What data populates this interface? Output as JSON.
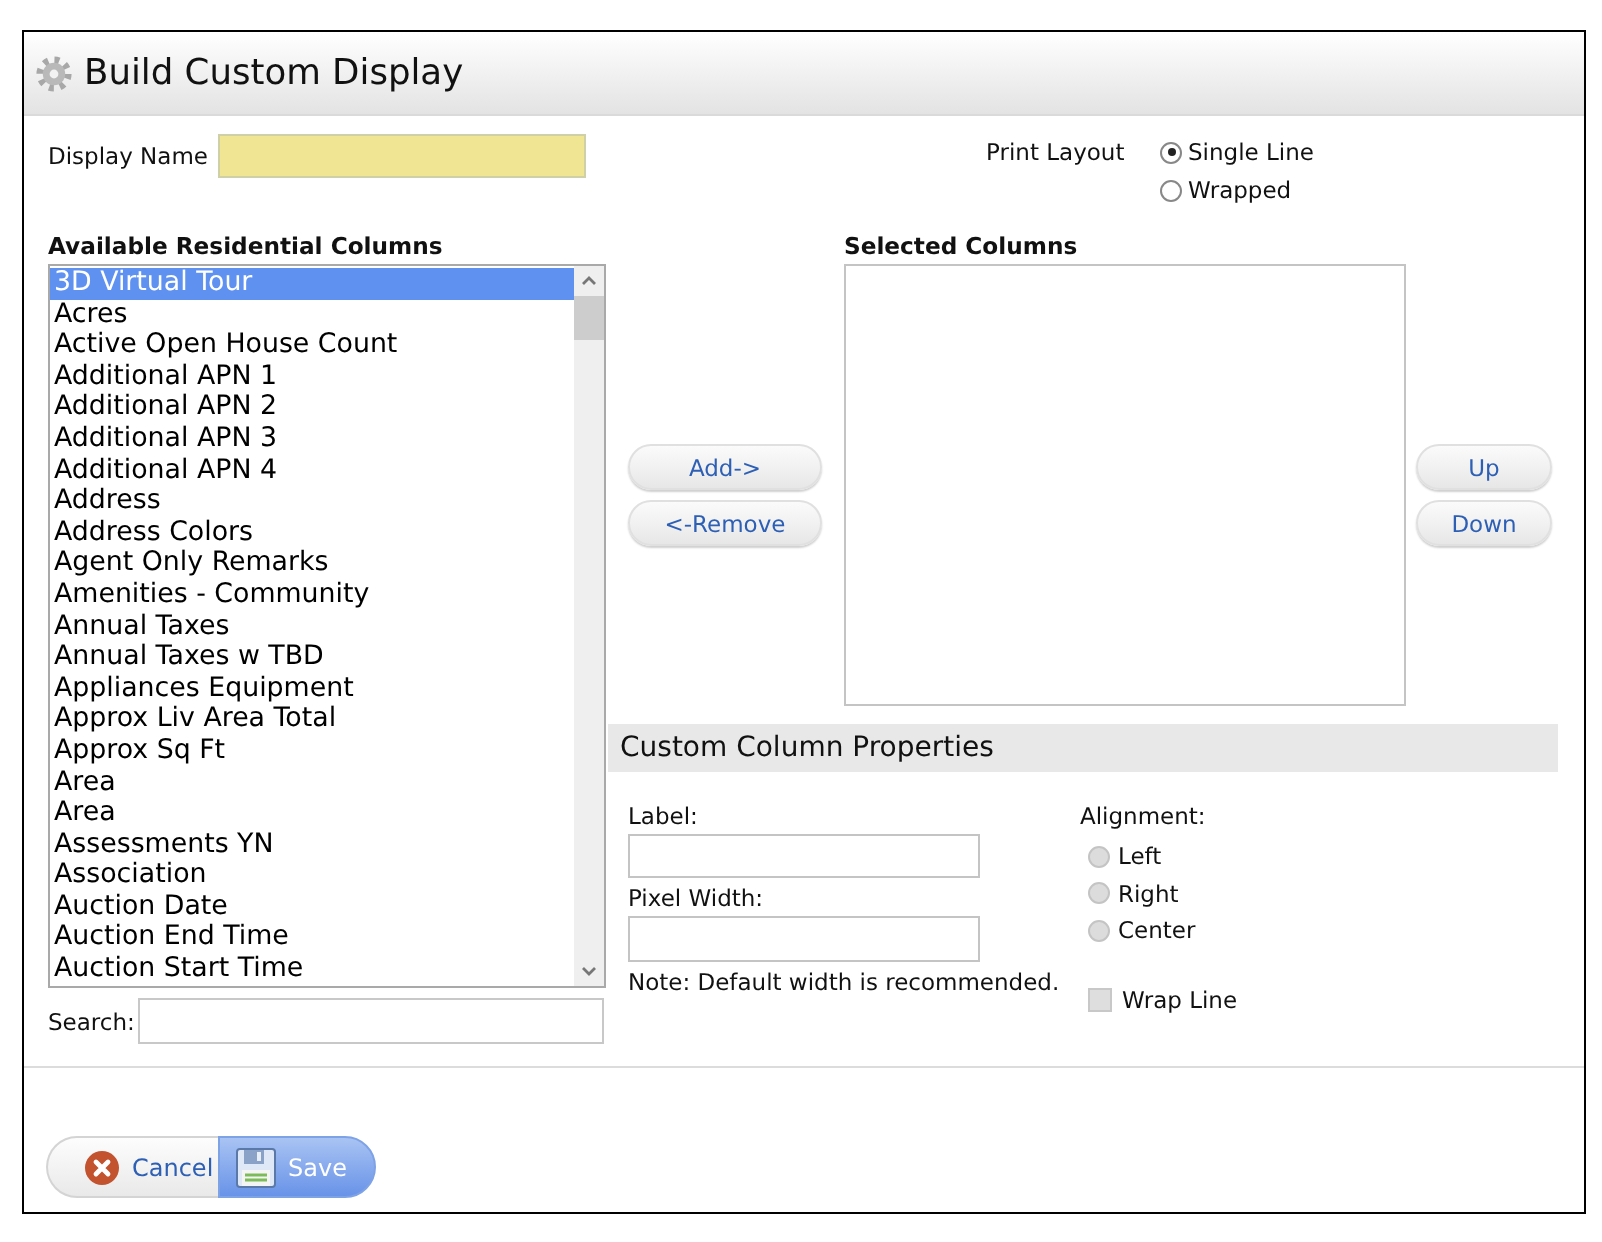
{
  "window": {
    "title": "Build Custom Display"
  },
  "display_name": {
    "label": "Display Name"
  },
  "print_layout": {
    "label": "Print Layout",
    "options": [
      {
        "label": "Single Line",
        "selected": true
      },
      {
        "label": "Wrapped",
        "selected": false
      }
    ]
  },
  "available_columns": {
    "title": "Available Residential Columns",
    "items": [
      {
        "label": "3D Virtual Tour",
        "selected": true
      },
      {
        "label": "Acres",
        "selected": false
      },
      {
        "label": "Active Open House Count",
        "selected": false
      },
      {
        "label": "Additional APN 1",
        "selected": false
      },
      {
        "label": "Additional APN 2",
        "selected": false
      },
      {
        "label": "Additional APN 3",
        "selected": false
      },
      {
        "label": "Additional APN 4",
        "selected": false
      },
      {
        "label": "Address",
        "selected": false
      },
      {
        "label": "Address Colors",
        "selected": false
      },
      {
        "label": "Agent Only Remarks",
        "selected": false
      },
      {
        "label": "Amenities - Community",
        "selected": false
      },
      {
        "label": "Annual Taxes",
        "selected": false
      },
      {
        "label": "Annual Taxes w TBD",
        "selected": false
      },
      {
        "label": "Appliances Equipment",
        "selected": false
      },
      {
        "label": "Approx Liv Area Total",
        "selected": false
      },
      {
        "label": "Approx Sq Ft",
        "selected": false
      },
      {
        "label": "Area",
        "selected": false
      },
      {
        "label": "Area",
        "selected": false
      },
      {
        "label": "Assessments YN",
        "selected": false
      },
      {
        "label": "Association",
        "selected": false
      },
      {
        "label": "Auction Date",
        "selected": false
      },
      {
        "label": "Auction End Time",
        "selected": false
      },
      {
        "label": "Auction Start Time",
        "selected": false
      }
    ],
    "search_label": "Search:"
  },
  "transfer_buttons": [
    "Add->",
    "<-Remove"
  ],
  "selected_columns": {
    "title": "Selected Columns"
  },
  "order_buttons": [
    "Up",
    "Down"
  ],
  "custom_column_properties": {
    "title": "Custom Column Properties",
    "label_field": {
      "label": "Label:"
    },
    "width_field": {
      "label": "Pixel Width:"
    },
    "note": "Note: Default width is recommended.",
    "alignment": {
      "label": "Alignment:",
      "options": [
        {
          "label": "Left",
          "selected": false,
          "disabled": true
        },
        {
          "label": "Right",
          "selected": false,
          "disabled": true
        },
        {
          "label": "Center",
          "selected": false,
          "disabled": true
        }
      ]
    },
    "wrap_line": {
      "label": "Wrap Line",
      "checked": false,
      "disabled": true
    }
  },
  "footer_buttons": [
    {
      "kind": "cancel",
      "label": "Cancel"
    },
    {
      "kind": "save",
      "label": "Save"
    }
  ]
}
